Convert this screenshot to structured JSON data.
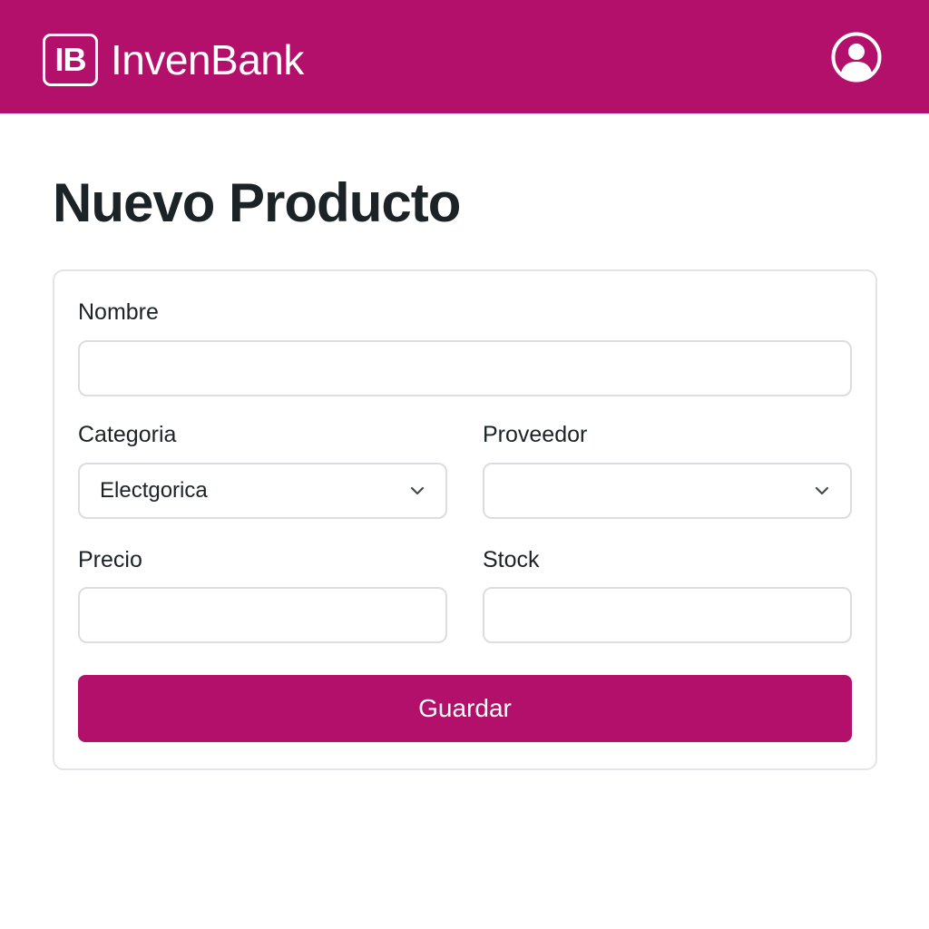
{
  "header": {
    "logo_text": "IB",
    "brand_name": "InvenBank",
    "profile_icon": "user-circle-icon",
    "bar_color": "#b2106a"
  },
  "page": {
    "title": "Nuevo Producto"
  },
  "form": {
    "nombre": {
      "label": "Nombre",
      "value": ""
    },
    "categoria": {
      "label": "Categoria",
      "selected": "Electgorica",
      "icon": "chevron-down-icon"
    },
    "proveedor": {
      "label": "Proveedor",
      "selected": "",
      "icon": "chevron-down-icon"
    },
    "precio": {
      "label": "Precio",
      "value": ""
    },
    "stock": {
      "label": "Stock",
      "value": ""
    },
    "submit_label": "Guardar",
    "accent_color": "#b2106a"
  }
}
